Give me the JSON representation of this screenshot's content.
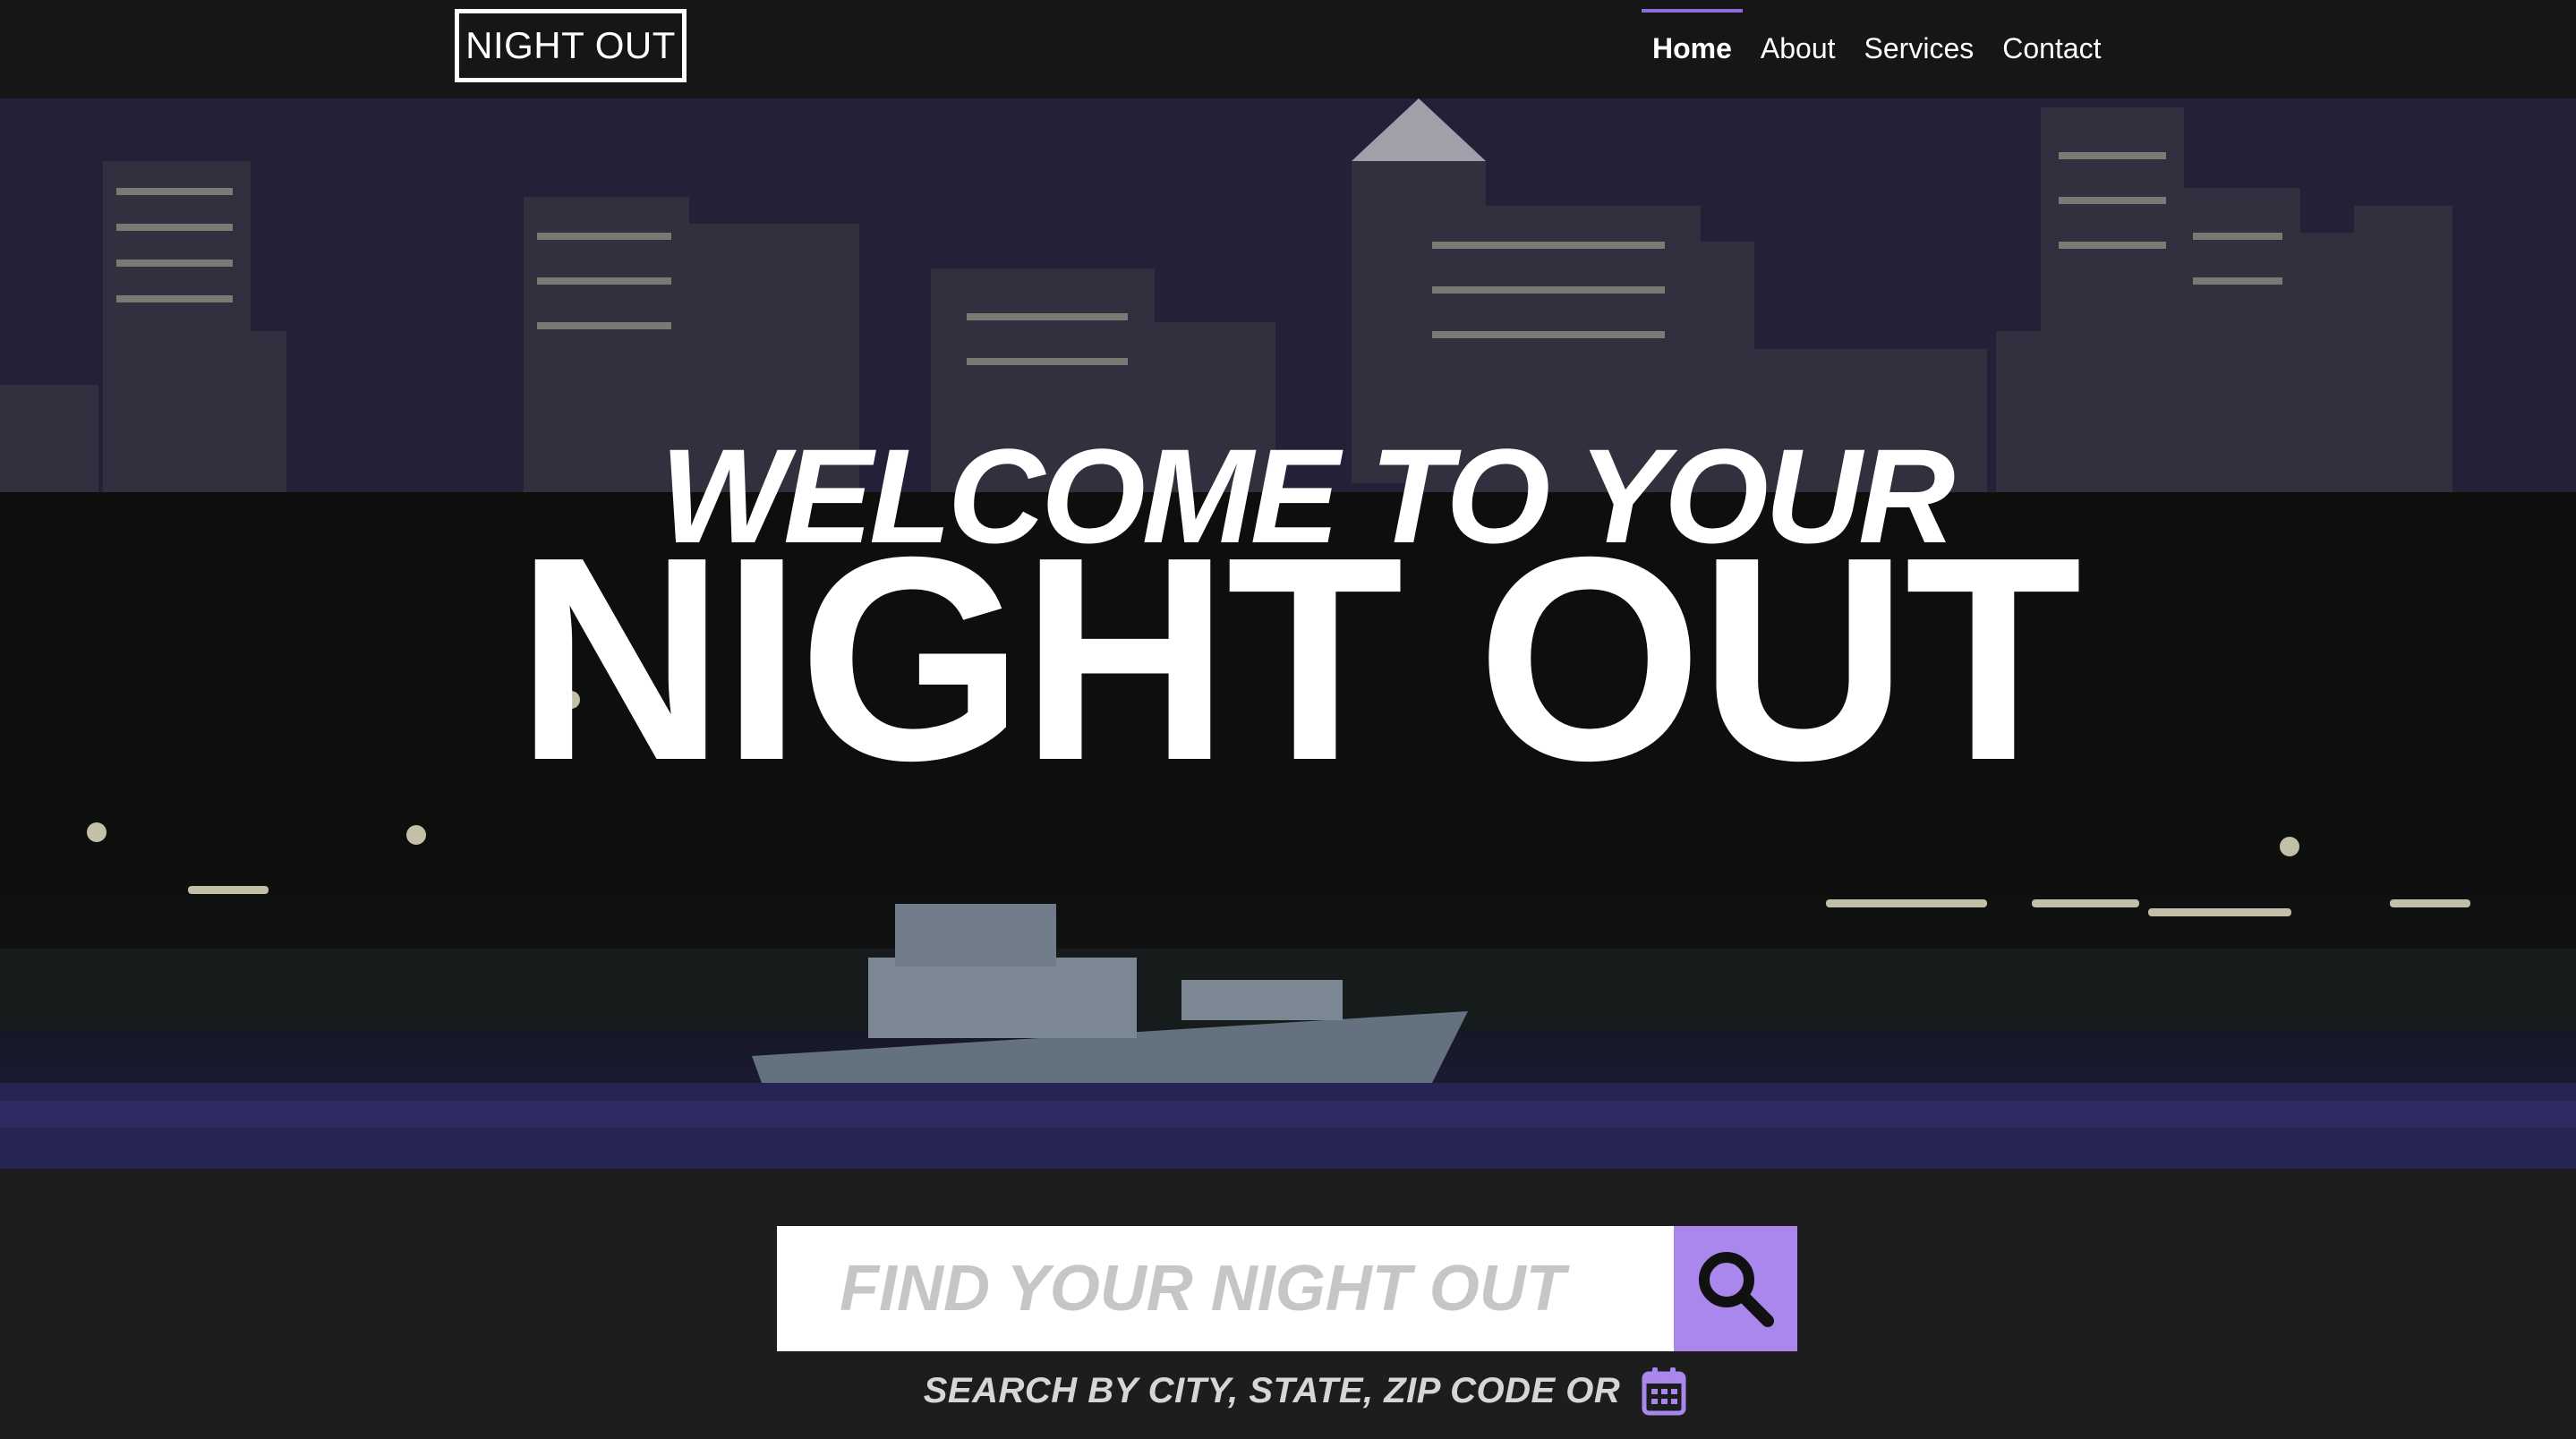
{
  "nav": {
    "brand": "NIGHT OUT",
    "links": [
      {
        "label": "Home",
        "active": true
      },
      {
        "label": "About",
        "active": false
      },
      {
        "label": "Services",
        "active": false
      },
      {
        "label": "Contact",
        "active": false
      }
    ]
  },
  "hero": {
    "line1": "WELCOME TO YOUR",
    "line2": "NIGHT OUT",
    "background_image": "night city skyline over marina with yacht"
  },
  "search": {
    "placeholder": "FIND YOUR NIGHT OUT",
    "value": "",
    "button_icon": "search-icon",
    "hint": "SEARCH BY CITY, STATE, ZIP CODE OR",
    "hint_icon": "calendar-icon"
  },
  "colors": {
    "navbar_bg": "#161616",
    "page_bg": "#1d1d1d",
    "accent": "#a987ec",
    "active_indicator": "#8e6bd9",
    "text": "#ffffff"
  }
}
